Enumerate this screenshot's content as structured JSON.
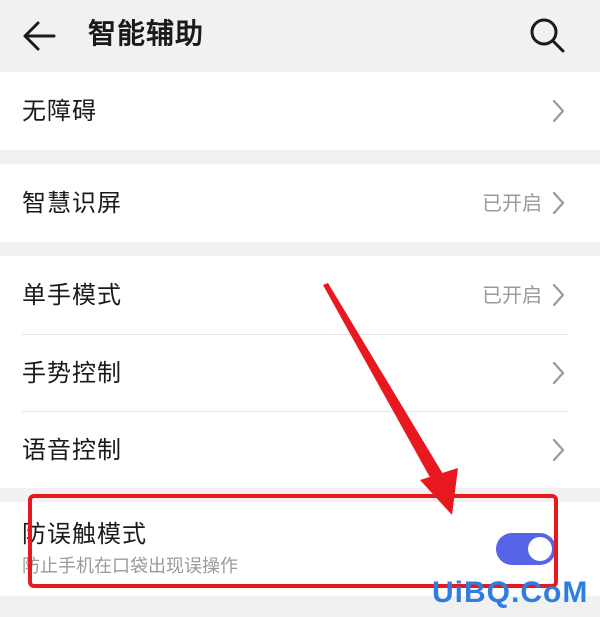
{
  "header": {
    "title": "智能辅助",
    "back_icon": "arrow-left-icon",
    "search_icon": "search-icon"
  },
  "settings": {
    "accessibility": {
      "label": "无障碍"
    },
    "smart_screen": {
      "label": "智慧识屏",
      "status": "已开启"
    },
    "one_hand_mode": {
      "label": "单手模式",
      "status": "已开启"
    },
    "gesture_control": {
      "label": "手势控制"
    },
    "voice_control": {
      "label": "语音控制"
    },
    "accidental_touch": {
      "label": "防误触模式",
      "description": "防止手机在口袋出现误操作",
      "enabled": true
    }
  },
  "colors": {
    "toggle_on": "#5864e8",
    "annotation": "#e8191e",
    "watermark": "#2e7de0"
  },
  "watermark": "UiBQ.CoM"
}
